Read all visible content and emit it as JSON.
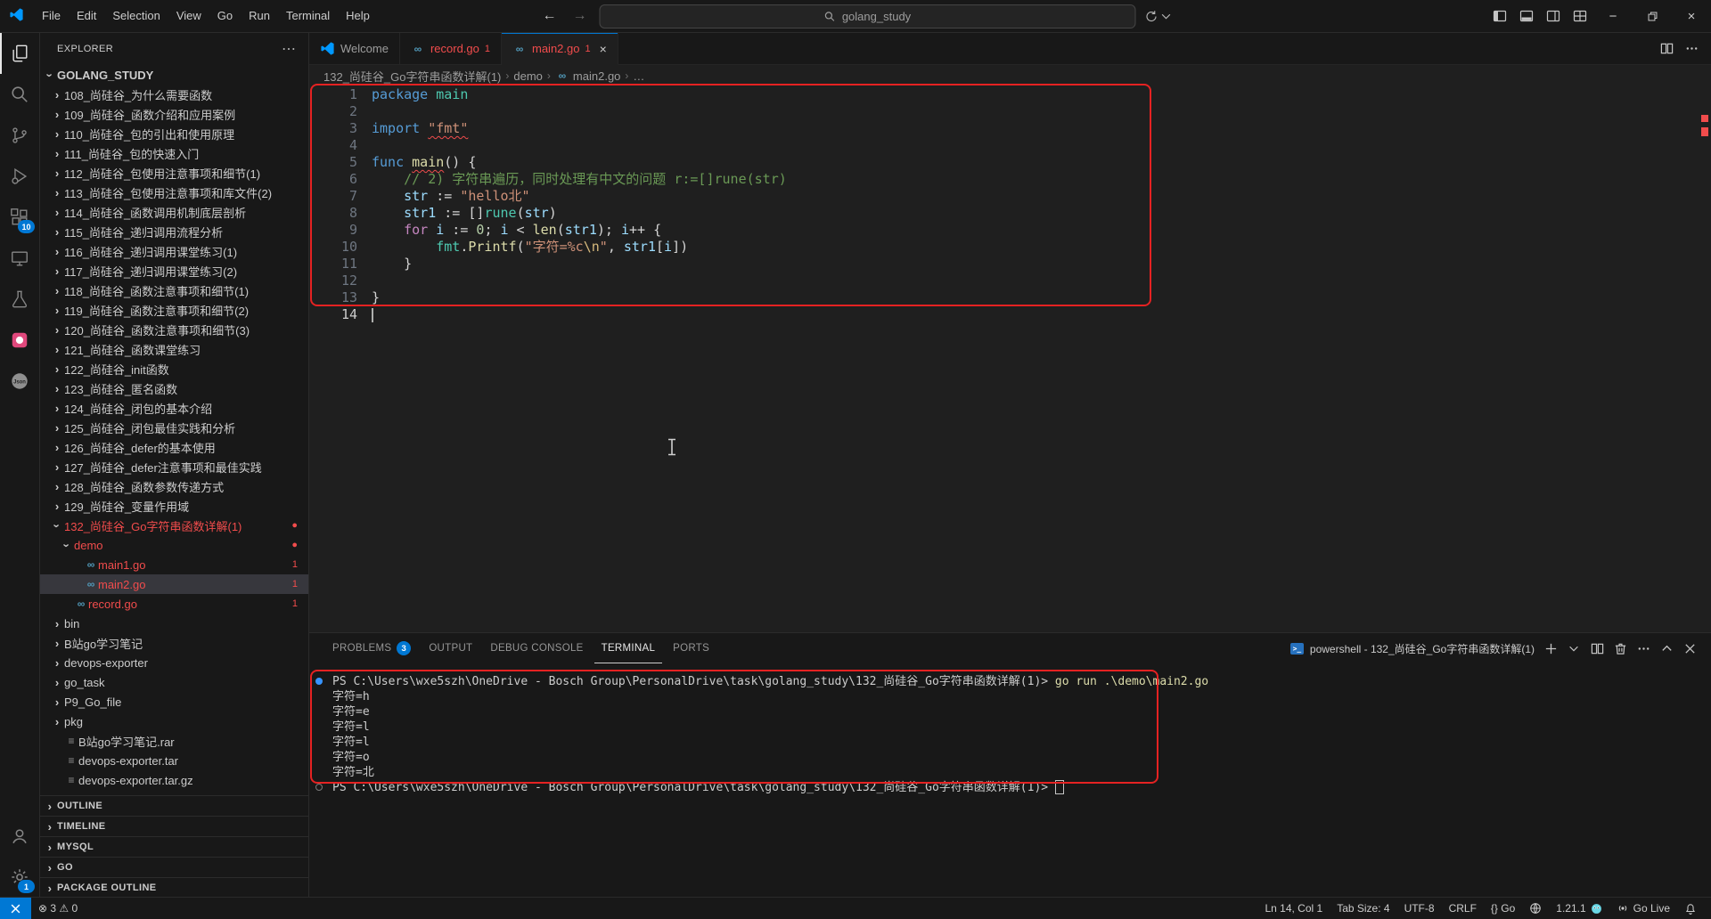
{
  "titlebar": {
    "menus": [
      "File",
      "Edit",
      "Selection",
      "View",
      "Go",
      "Run",
      "Terminal",
      "Help"
    ],
    "search_value": "golang_study"
  },
  "activity_bar": {
    "top": [
      {
        "name": "explorer-icon",
        "icon": "files",
        "active": true
      },
      {
        "name": "search-icon",
        "icon": "search"
      },
      {
        "name": "source-control-icon",
        "icon": "git"
      },
      {
        "name": "run-debug-icon",
        "icon": "debug"
      },
      {
        "name": "extensions-icon",
        "icon": "ext",
        "badge": "10"
      },
      {
        "name": "remote-explorer-icon",
        "icon": "remotex"
      },
      {
        "name": "testing-icon",
        "icon": "beaker"
      },
      {
        "name": "custom-extension-icon",
        "icon": "pink"
      },
      {
        "name": "json-icon",
        "icon": "json"
      }
    ],
    "bottom": [
      {
        "name": "accounts-icon",
        "icon": "account"
      },
      {
        "name": "settings-icon",
        "icon": "gear",
        "badge": "1"
      }
    ]
  },
  "sidebar": {
    "title": "EXPLORER",
    "root": "GOLANG_STUDY",
    "tree": [
      {
        "label": "108_尚硅谷_为什么需要函数",
        "level": 1,
        "kind": "folder"
      },
      {
        "label": "109_尚硅谷_函数介绍和应用案例",
        "level": 1,
        "kind": "folder"
      },
      {
        "label": "110_尚硅谷_包的引出和使用原理",
        "level": 1,
        "kind": "folder"
      },
      {
        "label": "111_尚硅谷_包的快速入门",
        "level": 1,
        "kind": "folder"
      },
      {
        "label": "112_尚硅谷_包使用注意事项和细节(1)",
        "level": 1,
        "kind": "folder"
      },
      {
        "label": "113_尚硅谷_包使用注意事项和库文件(2)",
        "level": 1,
        "kind": "folder"
      },
      {
        "label": "114_尚硅谷_函数调用机制底层剖析",
        "level": 1,
        "kind": "folder"
      },
      {
        "label": "115_尚硅谷_递归调用流程分析",
        "level": 1,
        "kind": "folder"
      },
      {
        "label": "116_尚硅谷_递归调用课堂练习(1)",
        "level": 1,
        "kind": "folder"
      },
      {
        "label": "117_尚硅谷_递归调用课堂练习(2)",
        "level": 1,
        "kind": "folder"
      },
      {
        "label": "118_尚硅谷_函数注意事项和细节(1)",
        "level": 1,
        "kind": "folder"
      },
      {
        "label": "119_尚硅谷_函数注意事项和细节(2)",
        "level": 1,
        "kind": "folder"
      },
      {
        "label": "120_尚硅谷_函数注意事项和细节(3)",
        "level": 1,
        "kind": "folder"
      },
      {
        "label": "121_尚硅谷_函数课堂练习",
        "level": 1,
        "kind": "folder"
      },
      {
        "label": "122_尚硅谷_init函数",
        "level": 1,
        "kind": "folder"
      },
      {
        "label": "123_尚硅谷_匿名函数",
        "level": 1,
        "kind": "folder"
      },
      {
        "label": "124_尚硅谷_闭包的基本介绍",
        "level": 1,
        "kind": "folder"
      },
      {
        "label": "125_尚硅谷_闭包最佳实践和分析",
        "level": 1,
        "kind": "folder"
      },
      {
        "label": "126_尚硅谷_defer的基本使用",
        "level": 1,
        "kind": "folder"
      },
      {
        "label": "127_尚硅谷_defer注意事项和最佳实践",
        "level": 1,
        "kind": "folder"
      },
      {
        "label": "128_尚硅谷_函数参数传递方式",
        "level": 1,
        "kind": "folder"
      },
      {
        "label": "129_尚硅谷_变量作用域",
        "level": 1,
        "kind": "folder"
      },
      {
        "label": "132_尚硅谷_Go字符串函数详解(1)",
        "level": 1,
        "kind": "folder",
        "open": true,
        "error": true,
        "badge": "dot"
      },
      {
        "label": "demo",
        "level": 2,
        "kind": "folder",
        "open": true,
        "error": true,
        "badge": "dot"
      },
      {
        "label": "main1.go",
        "level": 3,
        "kind": "go",
        "error": true,
        "badge": "1"
      },
      {
        "label": "main2.go",
        "level": 3,
        "kind": "go",
        "error": true,
        "badge": "1",
        "selected": true
      },
      {
        "label": "record.go",
        "level": 2,
        "kind": "go",
        "error": true,
        "badge": "1"
      },
      {
        "label": "bin",
        "level": 1,
        "kind": "folder"
      },
      {
        "label": "B站go学习笔记",
        "level": 1,
        "kind": "folder"
      },
      {
        "label": "devops-exporter",
        "level": 1,
        "kind": "folder"
      },
      {
        "label": "go_task",
        "level": 1,
        "kind": "folder"
      },
      {
        "label": "P9_Go_file",
        "level": 1,
        "kind": "folder"
      },
      {
        "label": "pkg",
        "level": 1,
        "kind": "folder"
      },
      {
        "label": "B站go学习笔记.rar",
        "level": 1,
        "kind": "file"
      },
      {
        "label": "devops-exporter.tar",
        "level": 1,
        "kind": "file"
      },
      {
        "label": "devops-exporter.tar.gz",
        "level": 1,
        "kind": "file"
      }
    ],
    "sections": [
      "OUTLINE",
      "TIMELINE",
      "MYSQL",
      "GO",
      "PACKAGE OUTLINE"
    ]
  },
  "editor": {
    "tabs": [
      {
        "label": "Welcome",
        "icon": "vscode"
      },
      {
        "label": "record.go",
        "icon": "go",
        "error": true,
        "badge": "1"
      },
      {
        "label": "main2.go",
        "icon": "go",
        "error": true,
        "badge": "1",
        "active": true,
        "close": true
      }
    ],
    "breadcrumb": [
      "132_尚硅谷_Go字符串函数详解(1)",
      "demo",
      "main2.go",
      "…"
    ],
    "code": {
      "lines": [
        {
          "n": 1,
          "tokens": [
            {
              "c": "kw",
              "t": "package"
            },
            {
              "c": "plain",
              "t": " "
            },
            {
              "c": "type",
              "t": "main"
            }
          ]
        },
        {
          "n": 2,
          "tokens": []
        },
        {
          "n": 3,
          "tokens": [
            {
              "c": "kw",
              "t": "import"
            },
            {
              "c": "plain",
              "t": " "
            },
            {
              "c": "str",
              "t": "\"fmt\"",
              "sq": true
            }
          ]
        },
        {
          "n": 4,
          "tokens": []
        },
        {
          "n": 5,
          "tokens": [
            {
              "c": "kw",
              "t": "func"
            },
            {
              "c": "plain",
              "t": " "
            },
            {
              "c": "fn",
              "t": "main",
              "sq": true
            },
            {
              "c": "plain",
              "t": "() {"
            }
          ]
        },
        {
          "n": 6,
          "tokens": [
            {
              "c": "plain",
              "t": "    "
            },
            {
              "c": "cmt",
              "t": "// 2) 字符串遍历，同时处理有中文的问题 r:=[]rune(str)"
            }
          ]
        },
        {
          "n": 7,
          "tokens": [
            {
              "c": "plain",
              "t": "    "
            },
            {
              "c": "var",
              "t": "str"
            },
            {
              "c": "plain",
              "t": " := "
            },
            {
              "c": "str",
              "t": "\"hello北\""
            }
          ]
        },
        {
          "n": 8,
          "tokens": [
            {
              "c": "plain",
              "t": "    "
            },
            {
              "c": "var",
              "t": "str1"
            },
            {
              "c": "plain",
              "t": " := []"
            },
            {
              "c": "type",
              "t": "rune"
            },
            {
              "c": "plain",
              "t": "("
            },
            {
              "c": "var",
              "t": "str"
            },
            {
              "c": "plain",
              "t": ")"
            }
          ]
        },
        {
          "n": 9,
          "tokens": [
            {
              "c": "plain",
              "t": "    "
            },
            {
              "c": "ctrl",
              "t": "for"
            },
            {
              "c": "plain",
              "t": " "
            },
            {
              "c": "var",
              "t": "i"
            },
            {
              "c": "plain",
              "t": " := "
            },
            {
              "c": "num",
              "t": "0"
            },
            {
              "c": "plain",
              "t": "; "
            },
            {
              "c": "var",
              "t": "i"
            },
            {
              "c": "plain",
              "t": " < "
            },
            {
              "c": "fn",
              "t": "len"
            },
            {
              "c": "plain",
              "t": "("
            },
            {
              "c": "var",
              "t": "str1"
            },
            {
              "c": "plain",
              "t": "); "
            },
            {
              "c": "var",
              "t": "i"
            },
            {
              "c": "plain",
              "t": "++ {"
            }
          ]
        },
        {
          "n": 10,
          "tokens": [
            {
              "c": "plain",
              "t": "        "
            },
            {
              "c": "type",
              "t": "fmt"
            },
            {
              "c": "plain",
              "t": "."
            },
            {
              "c": "fn",
              "t": "Printf"
            },
            {
              "c": "plain",
              "t": "("
            },
            {
              "c": "str",
              "t": "\"字符=%c"
            },
            {
              "c": "esc",
              "t": "\\n"
            },
            {
              "c": "str",
              "t": "\""
            },
            {
              "c": "plain",
              "t": ", "
            },
            {
              "c": "var",
              "t": "str1"
            },
            {
              "c": "plain",
              "t": "["
            },
            {
              "c": "var",
              "t": "i"
            },
            {
              "c": "plain",
              "t": "])"
            }
          ]
        },
        {
          "n": 11,
          "tokens": [
            {
              "c": "plain",
              "t": "    }"
            }
          ]
        },
        {
          "n": 12,
          "tokens": []
        },
        {
          "n": 13,
          "tokens": [
            {
              "c": "plain",
              "t": "}"
            }
          ]
        },
        {
          "n": 14,
          "tokens": [],
          "active": true,
          "cursor": true
        }
      ]
    }
  },
  "panel": {
    "tabs": [
      {
        "label": "PROBLEMS",
        "badge": "3"
      },
      {
        "label": "OUTPUT"
      },
      {
        "label": "DEBUG CONSOLE"
      },
      {
        "label": "TERMINAL",
        "active": true
      },
      {
        "label": "PORTS"
      }
    ],
    "terminal_title": "powershell - 132_尚硅谷_Go字符串函数详解(1)",
    "terminal": {
      "lines": [
        {
          "dec": "filled",
          "segs": [
            {
              "c": "",
              "t": "PS C:\\Users\\wxe5szh\\OneDrive - Bosch Group\\PersonalDrive\\task\\golang_study\\132_尚硅谷_Go字符串函数详解(1)> "
            },
            {
              "c": "cmd",
              "t": "go run .\\demo\\main2.go"
            }
          ]
        },
        {
          "segs": [
            {
              "c": "",
              "t": "字符=h"
            }
          ]
        },
        {
          "segs": [
            {
              "c": "",
              "t": "字符=e"
            }
          ]
        },
        {
          "segs": [
            {
              "c": "",
              "t": "字符=l"
            }
          ]
        },
        {
          "segs": [
            {
              "c": "",
              "t": "字符=l"
            }
          ]
        },
        {
          "segs": [
            {
              "c": "",
              "t": "字符=o"
            }
          ]
        },
        {
          "segs": [
            {
              "c": "",
              "t": "字符=北"
            }
          ]
        },
        {
          "dec": "hollow",
          "cursor": true,
          "segs": [
            {
              "c": "",
              "t": "PS C:\\Users\\wxe5szh\\OneDrive - Bosch Group\\PersonalDrive\\task\\golang_study\\132_尚硅谷_Go字符串函数详解(1)> "
            }
          ]
        }
      ]
    }
  },
  "status_bar": {
    "left": [
      {
        "name": "remote-indicator",
        "icon": "remote",
        "text": "",
        "accent": true
      },
      {
        "name": "problems-status",
        "text": "⊗ 3  ⚠ 0"
      }
    ],
    "right": [
      {
        "name": "cursor-position",
        "text": "Ln 14, Col 1"
      },
      {
        "name": "indentation",
        "text": "Tab Size: 4"
      },
      {
        "name": "encoding",
        "text": "UTF-8"
      },
      {
        "name": "eol-sequence",
        "text": "CRLF"
      },
      {
        "name": "language-mode",
        "text": "{} Go"
      },
      {
        "name": "browser-preview",
        "icon": "globe",
        "text": ""
      },
      {
        "name": "go-version",
        "text": "1.21.1",
        "icon_after": "gopher"
      },
      {
        "name": "go-live",
        "icon": "broadcast",
        "text": "Go Live"
      },
      {
        "name": "notifications",
        "icon": "bell",
        "text": ""
      }
    ]
  },
  "colors": {
    "accent": "#0078d4",
    "error": "#f14c4c",
    "annotation": "#e52222"
  }
}
